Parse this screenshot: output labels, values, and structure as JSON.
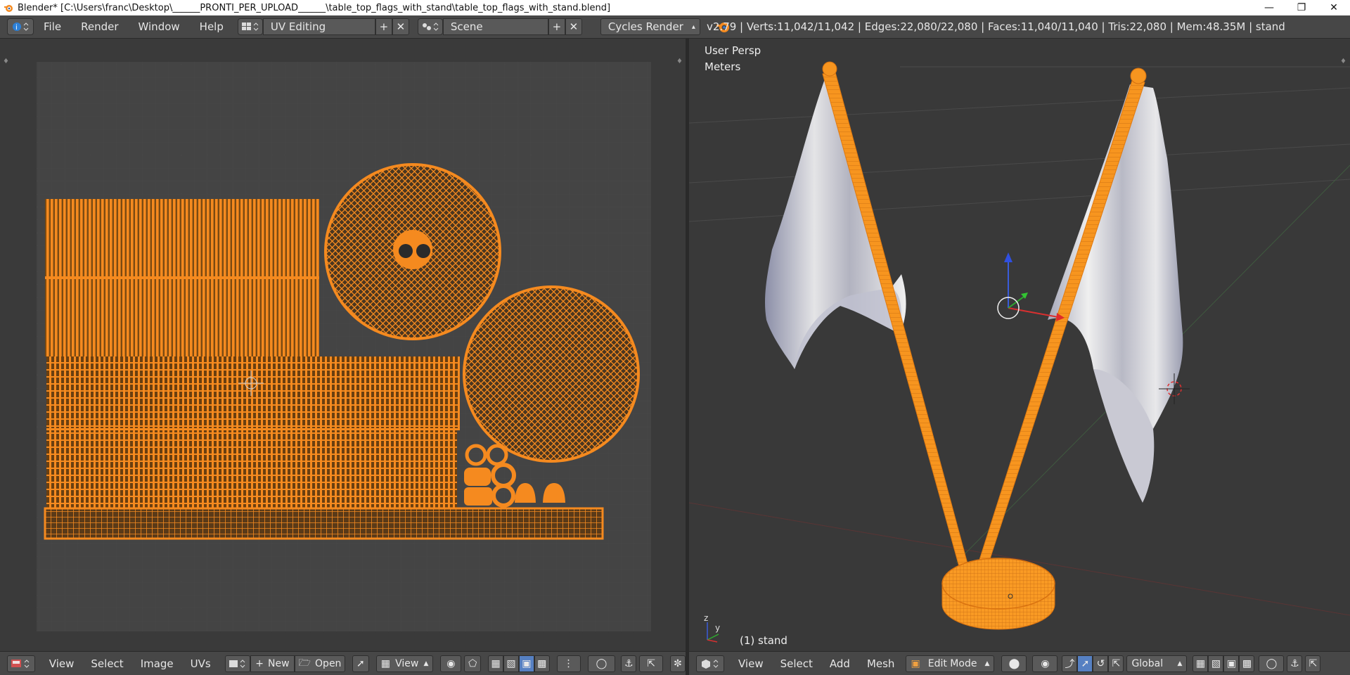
{
  "window": {
    "title": "Blender* [C:\\Users\\franc\\Desktop\\______PRONTI_PER_UPLOAD______\\table_top_flags_with_stand\\table_top_flags_with_stand.blend]",
    "minimize_icon": "minimize-icon",
    "maximize_icon": "restore-icon",
    "close_icon": "close-icon"
  },
  "infobar": {
    "menus": [
      "File",
      "Render",
      "Window",
      "Help"
    ],
    "screen_layout": "UV Editing",
    "scene": "Scene",
    "render_engine": "Cycles Render",
    "stats": "v2.79 | Verts:11,042/11,042 | Edges:22,080/22,080 | Faces:11,040/11,040 | Tris:22,080 | Mem:48.35M | stand"
  },
  "uv_editor": {
    "menus": [
      "View",
      "Select",
      "Image",
      "UVs"
    ],
    "new_label": "New",
    "open_label": "Open",
    "view_label": "View"
  },
  "viewport": {
    "view_name": "User Persp",
    "units": "Meters",
    "object_label": "(1) stand",
    "menus": [
      "View",
      "Select",
      "Add",
      "Mesh"
    ],
    "mode": "Edit Mode",
    "orientation": "Global",
    "axis_z": "z",
    "axis_y": "y"
  },
  "colors": {
    "accent": "#f58a1f",
    "background": "#393939",
    "header": "#474747"
  }
}
